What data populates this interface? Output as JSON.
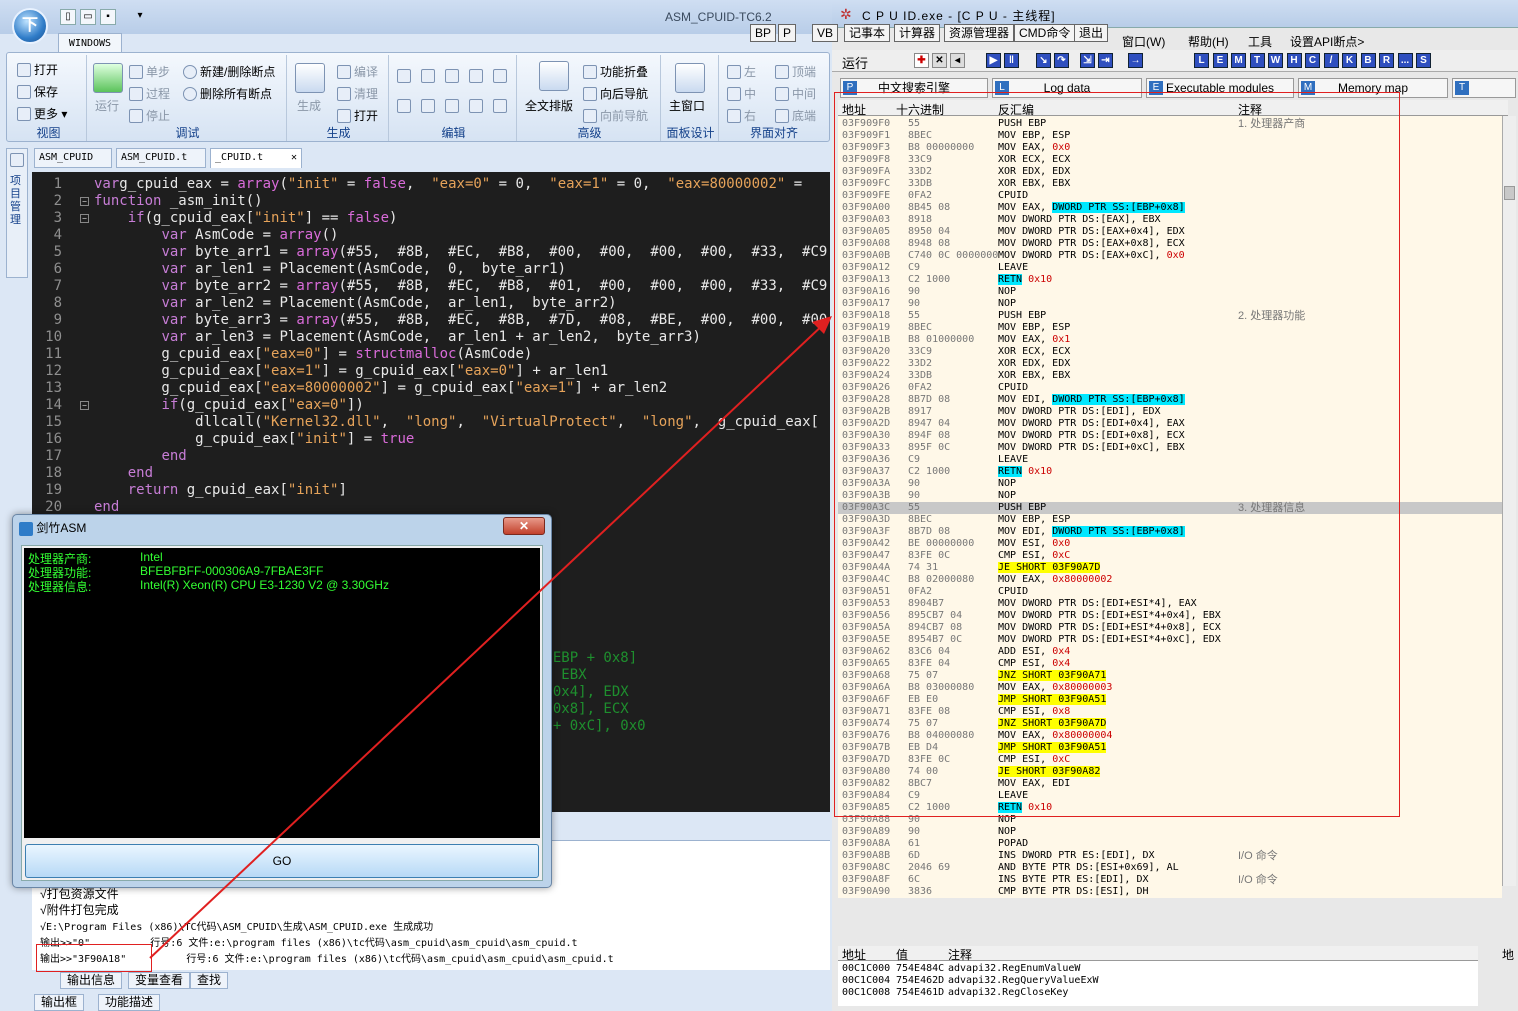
{
  "left": {
    "app_title": "ASM_CPUID-TC6.2",
    "orb_label": "下",
    "ribbon_tab": "WINDOWS",
    "groups": {
      "view": {
        "label": "视图",
        "items": [
          "打开",
          "保存",
          "更多 ▾"
        ]
      },
      "debug": {
        "label": "调试",
        "items": [
          "运行",
          "单步",
          "过程",
          "停止",
          "新建/删除断点",
          "删除所有断点"
        ]
      },
      "build": {
        "label": "生成",
        "items": [
          "生成",
          "编译",
          "清理",
          "打开"
        ]
      },
      "edit": {
        "label": "编辑"
      },
      "advanced": {
        "label": "高级",
        "items": [
          "全文排版",
          "功能折叠",
          "向后导航",
          "向前导航"
        ]
      },
      "panel": {
        "label": "面板设计",
        "items": [
          "主窗口"
        ]
      },
      "align": {
        "label": "界面对齐",
        "items": [
          "左",
          "中",
          "右",
          "顶端",
          "中间",
          "底端"
        ]
      }
    },
    "doc_tabs": [
      "ASM_CPUID",
      "ASM_CPUID.t",
      "_CPUID.t"
    ],
    "sidebar_label": "项目管理",
    "code_lines": [
      {
        "n": "1",
        "segs": [
          [
            "kw",
            "var"
          ],
          [
            "",
            "g_cpuid_eax = "
          ],
          [
            "fn",
            "array"
          ],
          [
            "",
            "("
          ],
          [
            "str",
            "\"init\""
          ],
          [
            "",
            " = "
          ],
          [
            "fn",
            "false"
          ],
          [
            "",
            ",  "
          ],
          [
            "str",
            "\"eax=0\""
          ],
          [
            "",
            " = 0,  "
          ],
          [
            "str",
            "\"eax=1\""
          ],
          [
            "",
            " = 0,  "
          ],
          [
            "str",
            "\"eax=80000002\""
          ],
          [
            "",
            " ="
          ]
        ]
      },
      {
        "n": "2",
        "segs": [
          [
            "kw",
            "function"
          ],
          [
            "",
            " _asm_init()"
          ]
        ]
      },
      {
        "n": "3",
        "segs": [
          [
            "",
            "    "
          ],
          [
            "kw",
            "if"
          ],
          [
            "",
            "(g_cpuid_eax["
          ],
          [
            "str",
            "\"init\""
          ],
          [
            "",
            "] == "
          ],
          [
            "fn",
            "false"
          ],
          [
            "",
            ")"
          ]
        ]
      },
      {
        "n": "4",
        "segs": [
          [
            "",
            "        "
          ],
          [
            "kw",
            "var"
          ],
          [
            "",
            " AsmCode = "
          ],
          [
            "fn",
            "array"
          ],
          [
            "",
            "()"
          ]
        ]
      },
      {
        "n": "5",
        "segs": [
          [
            "",
            "        "
          ],
          [
            "kw",
            "var"
          ],
          [
            "",
            " byte_arr1 = "
          ],
          [
            "fn",
            "array"
          ],
          [
            "",
            "(#55,  #8B,  #EC,  #B8,  #00,  #00,  #00,  #00,  #33,  #C9,  #3"
          ]
        ]
      },
      {
        "n": "6",
        "segs": [
          [
            "",
            "        "
          ],
          [
            "kw",
            "var"
          ],
          [
            "",
            " ar_len1 = Placement(AsmCode,  0,  byte_arr1)"
          ]
        ]
      },
      {
        "n": "7",
        "segs": [
          [
            "",
            "        "
          ],
          [
            "kw",
            "var"
          ],
          [
            "",
            " byte_arr2 = "
          ],
          [
            "fn",
            "array"
          ],
          [
            "",
            "(#55,  #8B,  #EC,  #B8,  #01,  #00,  #00,  #00,  #33,  #C9,  #3"
          ]
        ]
      },
      {
        "n": "8",
        "segs": [
          [
            "",
            "        "
          ],
          [
            "kw",
            "var"
          ],
          [
            "",
            " ar_len2 = Placement(AsmCode,  ar_len1,  byte_arr2)"
          ]
        ]
      },
      {
        "n": "9",
        "segs": [
          [
            "",
            "        "
          ],
          [
            "kw",
            "var"
          ],
          [
            "",
            " byte_arr3 = "
          ],
          [
            "fn",
            "array"
          ],
          [
            "",
            "(#55,  #8B,  #EC,  #8B,  #7D,  #08,  #BE,  #00,  #00,  #00,  #"
          ]
        ]
      },
      {
        "n": "10",
        "segs": [
          [
            "",
            "        "
          ],
          [
            "kw",
            "var"
          ],
          [
            "",
            " ar_len3 = Placement(AsmCode,  ar_len1 + ar_len2,  byte_arr3)"
          ]
        ]
      },
      {
        "n": "11",
        "segs": [
          [
            "",
            "        g_cpuid_eax["
          ],
          [
            "str",
            "\"eax=0\""
          ],
          [
            "",
            "] = "
          ],
          [
            "fn",
            "structmalloc"
          ],
          [
            "",
            "(AsmCode)"
          ]
        ]
      },
      {
        "n": "12",
        "segs": [
          [
            "",
            "        g_cpuid_eax["
          ],
          [
            "str",
            "\"eax=1\""
          ],
          [
            "",
            "] = g_cpuid_eax["
          ],
          [
            "str",
            "\"eax=0\""
          ],
          [
            "",
            "] + ar_len1"
          ]
        ]
      },
      {
        "n": "13",
        "segs": [
          [
            "",
            "        g_cpuid_eax["
          ],
          [
            "str",
            "\"eax=80000002\""
          ],
          [
            "",
            "] = g_cpuid_eax["
          ],
          [
            "str",
            "\"eax=1\""
          ],
          [
            "",
            "] + ar_len2"
          ]
        ]
      },
      {
        "n": "14",
        "segs": [
          [
            "",
            "        "
          ],
          [
            "kw",
            "if"
          ],
          [
            "",
            "(g_cpuid_eax["
          ],
          [
            "str",
            "\"eax=0\""
          ],
          [
            "",
            "])"
          ]
        ]
      },
      {
        "n": "15",
        "segs": [
          [
            "",
            "            dllcall("
          ],
          [
            "str",
            "\"Kernel32.dll\""
          ],
          [
            "",
            ",  "
          ],
          [
            "str",
            "\"long\""
          ],
          [
            "",
            ",  "
          ],
          [
            "str",
            "\"VirtualProtect\""
          ],
          [
            "",
            ",  "
          ],
          [
            "str",
            "\"long\""
          ],
          [
            "",
            ",  g_cpuid_eax["
          ]
        ]
      },
      {
        "n": "16",
        "segs": [
          [
            "",
            "            g_cpuid_eax["
          ],
          [
            "str",
            "\"init\""
          ],
          [
            "",
            "] = "
          ],
          [
            "fn",
            "true"
          ]
        ]
      },
      {
        "n": "17",
        "segs": [
          [
            "",
            "        "
          ],
          [
            "kw",
            "end"
          ]
        ]
      },
      {
        "n": "18",
        "segs": [
          [
            "",
            "    "
          ],
          [
            "kw",
            "end"
          ]
        ]
      },
      {
        "n": "19",
        "segs": [
          [
            "",
            "    "
          ],
          [
            "kw",
            "return"
          ],
          [
            "",
            " g_cpuid_eax["
          ],
          [
            "str",
            "\"init\""
          ],
          [
            "",
            "]"
          ]
        ]
      },
      {
        "n": "20",
        "segs": [
          [
            "kw",
            "end"
          ]
        ]
      }
    ],
    "ghost_lines": [
      ":[EBP + 0x8]",
      "], EBX",
      "+ 0x4], EDX",
      "+ 0x8], ECX",
      "X + 0xC], 0x0"
    ],
    "output_lines": [
      "√打包资源文件",
      "√附件打包完成",
      "√E:\\Program Files (x86)\\TC代码\\ASM_CPUID\\生成\\ASM_CPUID.exe 生成成功",
      "输出>>\"0\"          行号:6 文件:e:\\program files (x86)\\tc代码\\asm_cpuid\\asm_cpuid\\asm_cpuid.t",
      "输出>>\"3F90A18\"          行号:6 文件:e:\\program files (x86)\\tc代码\\asm_cpuid\\asm_cpuid\\asm_cpuid.t"
    ],
    "bottom_tabs": [
      "输出信息",
      "变量查看",
      "查找"
    ],
    "bottom_tabs2": [
      "输出框",
      "功能描述"
    ]
  },
  "asm_window": {
    "title": "剑竹ASM",
    "rows": [
      {
        "k": "处理器产商:",
        "v": "Intel"
      },
      {
        "k": "处理器功能:",
        "v": "BFEBFBFF-000306A9-7FBAE3FF"
      },
      {
        "k": "处理器信息:",
        "v": "Intel(R) Xeon(R) CPU E3-1230 V2 @ 3.30GHz"
      }
    ],
    "button": "GO"
  },
  "right": {
    "title": "C P U ID.exe - [C P U - 主线程]",
    "small_buttons": [
      "BP",
      "P",
      "VB",
      "记事本",
      "计算器",
      "资源管理器",
      "CMD命令",
      "退出"
    ],
    "menu": [
      "窗口(W)",
      "帮助(H)",
      "工具",
      "设置API断点>"
    ],
    "run_label": "运行",
    "tool_letters": [
      "L",
      "E",
      "M",
      "T",
      "W",
      "H",
      "C",
      "/",
      "K",
      "B",
      "R",
      "...",
      "S"
    ],
    "tabs": [
      "中文搜索引擎",
      "Log data",
      "Executable modules",
      "Memory map"
    ],
    "headers": [
      "地址",
      "十六进制",
      "反汇编",
      "注释"
    ],
    "rows": [
      [
        "03F909F0",
        "55",
        "PUSH EBP",
        "1. 处理器产商"
      ],
      [
        "03F909F1",
        "8BEC",
        "MOV EBP, ESP",
        ""
      ],
      [
        "03F909F3",
        "B8 00000000",
        "MOV EAX, 0x0",
        ""
      ],
      [
        "03F909F8",
        "33C9",
        "XOR ECX, ECX",
        ""
      ],
      [
        "03F909FA",
        "33D2",
        "XOR EDX, EDX",
        ""
      ],
      [
        "03F909FC",
        "33DB",
        "XOR EBX, EBX",
        ""
      ],
      [
        "03F909FE",
        "0FA2",
        "CPUID",
        ""
      ],
      [
        "03F90A00",
        "8B45 08",
        "MOV EAX, DWORD PTR SS:[EBP+0x8]",
        ""
      ],
      [
        "03F90A03",
        "8918",
        "MOV DWORD PTR DS:[EAX], EBX",
        ""
      ],
      [
        "03F90A05",
        "8950 04",
        "MOV DWORD PTR DS:[EAX+0x4], EDX",
        ""
      ],
      [
        "03F90A08",
        "8948 08",
        "MOV DWORD PTR DS:[EAX+0x8], ECX",
        ""
      ],
      [
        "03F90A0B",
        "C740 0C 0000000",
        "MOV DWORD PTR DS:[EAX+0xC], 0x0",
        ""
      ],
      [
        "03F90A12",
        "C9",
        "LEAVE",
        ""
      ],
      [
        "03F90A13",
        "C2 1000",
        "RETN 0x10",
        ""
      ],
      [
        "03F90A16",
        "90",
        "NOP",
        ""
      ],
      [
        "03F90A17",
        "90",
        "NOP",
        ""
      ],
      [
        "03F90A18",
        "55",
        "PUSH EBP",
        "2. 处理器功能"
      ],
      [
        "03F90A19",
        "8BEC",
        "MOV EBP, ESP",
        ""
      ],
      [
        "03F90A1B",
        "B8 01000000",
        "MOV EAX, 0x1",
        ""
      ],
      [
        "03F90A20",
        "33C9",
        "XOR ECX, ECX",
        ""
      ],
      [
        "03F90A22",
        "33D2",
        "XOR EDX, EDX",
        ""
      ],
      [
        "03F90A24",
        "33DB",
        "XOR EBX, EBX",
        ""
      ],
      [
        "03F90A26",
        "0FA2",
        "CPUID",
        ""
      ],
      [
        "03F90A28",
        "8B7D 08",
        "MOV EDI, DWORD PTR SS:[EBP+0x8]",
        ""
      ],
      [
        "03F90A2B",
        "8917",
        "MOV DWORD PTR DS:[EDI], EDX",
        ""
      ],
      [
        "03F90A2D",
        "8947 04",
        "MOV DWORD PTR DS:[EDI+0x4], EAX",
        ""
      ],
      [
        "03F90A30",
        "894F 08",
        "MOV DWORD PTR DS:[EDI+0x8], ECX",
        ""
      ],
      [
        "03F90A33",
        "895F 0C",
        "MOV DWORD PTR DS:[EDI+0xC], EBX",
        ""
      ],
      [
        "03F90A36",
        "C9",
        "LEAVE",
        ""
      ],
      [
        "03F90A37",
        "C2 1000",
        "RETN 0x10",
        ""
      ],
      [
        "03F90A3A",
        "90",
        "NOP",
        ""
      ],
      [
        "03F90A3B",
        "90",
        "NOP",
        ""
      ],
      [
        "03F90A3C",
        "55",
        "PUSH EBP",
        "3. 处理器信息"
      ],
      [
        "03F90A3D",
        "8BEC",
        "MOV EBP, ESP",
        ""
      ],
      [
        "03F90A3F",
        "8B7D 08",
        "MOV EDI, DWORD PTR SS:[EBP+0x8]",
        ""
      ],
      [
        "03F90A42",
        "BE 00000000",
        "MOV ESI, 0x0",
        ""
      ],
      [
        "03F90A47",
        "83FE 0C",
        "CMP ESI, 0xC",
        ""
      ],
      [
        "03F90A4A",
        "74 31",
        "JE SHORT 03F90A7D",
        ""
      ],
      [
        "03F90A4C",
        "B8 02000080",
        "MOV EAX, 0x80000002",
        ""
      ],
      [
        "03F90A51",
        "0FA2",
        "CPUID",
        ""
      ],
      [
        "03F90A53",
        "8904B7",
        "MOV DWORD PTR DS:[EDI+ESI*4], EAX",
        ""
      ],
      [
        "03F90A56",
        "895CB7 04",
        "MOV DWORD PTR DS:[EDI+ESI*4+0x4], EBX",
        ""
      ],
      [
        "03F90A5A",
        "894CB7 08",
        "MOV DWORD PTR DS:[EDI+ESI*4+0x8], ECX",
        ""
      ],
      [
        "03F90A5E",
        "8954B7 0C",
        "MOV DWORD PTR DS:[EDI+ESI*4+0xC], EDX",
        ""
      ],
      [
        "03F90A62",
        "83C6 04",
        "ADD ESI, 0x4",
        ""
      ],
      [
        "03F90A65",
        "83FE 04",
        "CMP ESI, 0x4",
        ""
      ],
      [
        "03F90A68",
        "75 07",
        "JNZ SHORT 03F90A71",
        ""
      ],
      [
        "03F90A6A",
        "B8 03000080",
        "MOV EAX, 0x80000003",
        ""
      ],
      [
        "03F90A6F",
        "EB E0",
        "JMP SHORT 03F90A51",
        ""
      ],
      [
        "03F90A71",
        "83FE 08",
        "CMP ESI, 0x8",
        ""
      ],
      [
        "03F90A74",
        "75 07",
        "JNZ SHORT 03F90A7D",
        ""
      ],
      [
        "03F90A76",
        "B8 04000080",
        "MOV EAX, 0x80000004",
        ""
      ],
      [
        "03F90A7B",
        "EB D4",
        "JMP SHORT 03F90A51",
        ""
      ],
      [
        "03F90A7D",
        "83FE 0C",
        "CMP ESI, 0xC",
        ""
      ],
      [
        "03F90A80",
        "74 00",
        "JE SHORT 03F90A82",
        ""
      ],
      [
        "03F90A82",
        "8BC7",
        "MOV EAX, EDI",
        ""
      ],
      [
        "03F90A84",
        "C9",
        "LEAVE",
        ""
      ],
      [
        "03F90A85",
        "C2 1000",
        "RETN 0x10",
        ""
      ],
      [
        "03F90A88",
        "90",
        "NOP",
        ""
      ],
      [
        "03F90A89",
        "90",
        "NOP",
        ""
      ],
      [
        "03F90A8A",
        "61",
        "POPAD",
        ""
      ],
      [
        "03F90A8B",
        "6D",
        "INS DWORD PTR ES:[EDI], DX",
        "I/O 命令"
      ],
      [
        "03F90A8C",
        "2046 69",
        "AND BYTE PTR DS:[ESI+0x69], AL",
        ""
      ],
      [
        "03F90A8F",
        "6C",
        "INS BYTE PTR ES:[EDI], DX",
        "I/O 命令"
      ],
      [
        "03F90A90",
        "3836",
        "CMP BYTE PTR DS:[ESI], DH",
        ""
      ]
    ],
    "selected_row": "03F90A3C",
    "dump_headers": [
      "地址",
      "值",
      "注释",
      "地"
    ],
    "dump_rows": [
      [
        "00C1C000",
        "754E484C",
        "advapi32.RegEnumValueW"
      ],
      [
        "00C1C004",
        "754E462D",
        "advapi32.RegQueryValueExW"
      ],
      [
        "00C1C008",
        "754E461D",
        "advapi32.RegCloseKey"
      ]
    ]
  }
}
